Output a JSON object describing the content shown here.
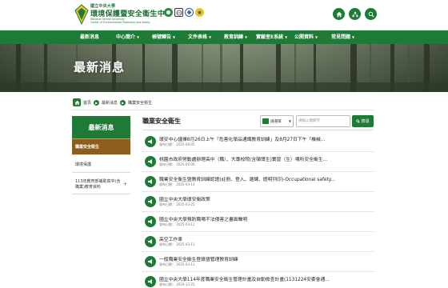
{
  "header": {
    "logo_small": "國立中央大學",
    "logo_title": "環境保護暨安全衛生中心",
    "logo_en_line1": "National Central University",
    "logo_en_line2": "Center of Environmental Protection and Safety",
    "icons": [
      "home-icon",
      "sitemap-icon",
      "search-icon"
    ]
  },
  "nav": {
    "items": [
      {
        "label": "最新消息",
        "has_menu": false
      },
      {
        "label": "中心簡介",
        "has_menu": true
      },
      {
        "label": "帳號轉告",
        "has_menu": true
      },
      {
        "label": "文件表格",
        "has_menu": true
      },
      {
        "label": "教育訓練",
        "has_menu": true
      },
      {
        "label": "實驗室E系統",
        "has_menu": true
      },
      {
        "label": "公開資料",
        "has_menu": true
      },
      {
        "label": "常見問題",
        "has_menu": true
      }
    ]
  },
  "banner": {
    "title": "最新消息"
  },
  "breadcrumb": {
    "home": "首頁",
    "level1": "最新消息",
    "level2": "職業安全衛生"
  },
  "sidebar": {
    "heading": "最新消息",
    "items": [
      {
        "label": "職業安全衛生",
        "active": true
      },
      {
        "label": "環境保護",
        "active": false
      },
      {
        "label": "113年教育部補助高中(含職業)教育資料",
        "active": false
      }
    ]
  },
  "content": {
    "title": "職業安全衛生",
    "filter_label": "請選擇",
    "search_placeholder": "請輸入關鍵字",
    "search_button": "搜尋",
    "news": [
      {
        "title": "環安中心謹擇8月26日上午「危害化學品通識教育訓練」及8月27日下午「機械...",
        "date": "發布日期： 2025-08-05"
      },
      {
        "title": "桃園市政府勞動處辦理高中（職）、大專校院(含碩博生)實習（生）場所安全衛生...",
        "date": "發布日期： 2025-06-06"
      },
      {
        "title": "職業安全衛生暨教育訓練認證(註冊、登入、選課、證明列印)-Occupational safety...",
        "date": "發布日期： 2025-04-14"
      },
      {
        "title": "國立中央大學環安衛政策",
        "date": "發布日期： 2025-03-25"
      },
      {
        "title": "國立中央大學預防職場不法侵害之書面聲明",
        "date": "發布日期： 2025-03-11"
      },
      {
        "title": "高空工作車",
        "date": "發布日期： 2025-03-11"
      },
      {
        "title": "一般職業安全衛生登錄暨管理教育訓練",
        "date": "發布日期： 2025-03-11"
      },
      {
        "title": "國立中央大學114年度職業安全衛生管理計畫及自動檢查計畫(1131224安委會通...",
        "date": "發布日期： 2024-12-25"
      }
    ]
  },
  "colors": {
    "brand_green": "#1f7a38",
    "active_brown": "#8c5e1e",
    "gold": "#c9a34a"
  }
}
